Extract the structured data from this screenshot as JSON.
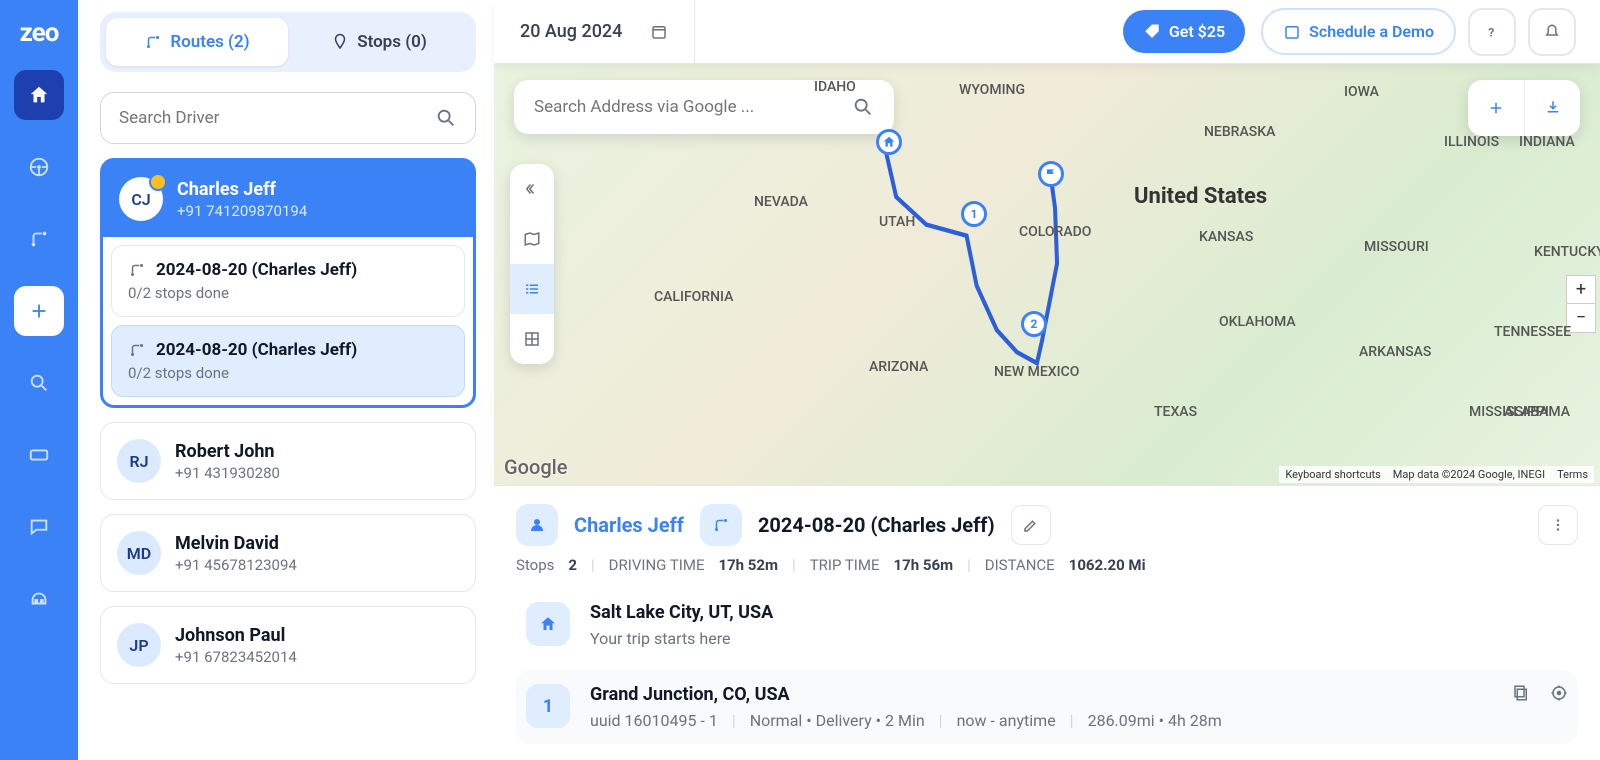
{
  "brand": "zeo",
  "tabs": {
    "routes": "Routes (2)",
    "stops": "Stops (0)"
  },
  "search_driver_placeholder": "Search Driver",
  "drivers": [
    {
      "initials": "CJ",
      "name": "Charles Jeff",
      "phone": "+91 741209870194",
      "starred": true
    },
    {
      "initials": "RJ",
      "name": "Robert John",
      "phone": "+91 431930280"
    },
    {
      "initials": "MD",
      "name": "Melvin David",
      "phone": "+91 45678123094"
    },
    {
      "initials": "JP",
      "name": "Johnson Paul",
      "phone": "+91 67823452014"
    }
  ],
  "routes": [
    {
      "title": "2024-08-20 (Charles Jeff)",
      "sub": "0/2 stops done"
    },
    {
      "title": "2024-08-20 (Charles Jeff)",
      "sub": "0/2 stops done"
    }
  ],
  "topbar": {
    "date": "20 Aug 2024",
    "get_label": "Get $25",
    "demo_label": "Schedule a Demo"
  },
  "search_address_placeholder": "Search Address via Google ...",
  "map": {
    "credit": "Google",
    "shortcuts": "Keyboard shortcuts",
    "copyright": "Map data ©2024 Google, INEGI",
    "terms": "Terms",
    "labels": {
      "us": "United States",
      "idaho": "IDAHO",
      "wyoming": "WYOMING",
      "nevada": "NEVADA",
      "utah": "UTAH",
      "colorado": "COLORADO",
      "california": "CALIFORNIA",
      "arizona": "ARIZONA",
      "newmexico": "NEW MEXICO",
      "oklahoma": "OKLAHOMA",
      "texas": "TEXAS",
      "kansas": "KANSAS",
      "nebraska": "NEBRASKA",
      "iowa": "IOWA",
      "missouri": "MISSOURI",
      "arkansas": "ARKANSAS",
      "tennessee": "TENNESSEE",
      "kentucky": "KENTUCKY",
      "illinois": "ILLINOIS",
      "indiana": "INDIANA",
      "mississippi": "MISSISSIPPI",
      "alabama": "ALABAMA"
    }
  },
  "detail": {
    "driver": "Charles Jeff",
    "route": "2024-08-20 (Charles Jeff)",
    "stops_label": "Stops",
    "stops_value": "2",
    "driving_label": "DRIVING TIME",
    "driving_value": "17h 52m",
    "trip_label": "TRIP TIME",
    "trip_value": "17h 56m",
    "distance_label": "DISTANCE",
    "distance_value": "1062.20 Mi",
    "start": {
      "title": "Salt Lake City, UT, USA",
      "sub": "Your trip starts here"
    },
    "stop1": {
      "num": "1",
      "title": "Grand Junction, CO, USA",
      "uuid": "uuid 16010495 - 1",
      "type": "Normal • Delivery • 2 Min",
      "window": "now - anytime",
      "dist": "286.09mi • 4h 28m"
    }
  }
}
